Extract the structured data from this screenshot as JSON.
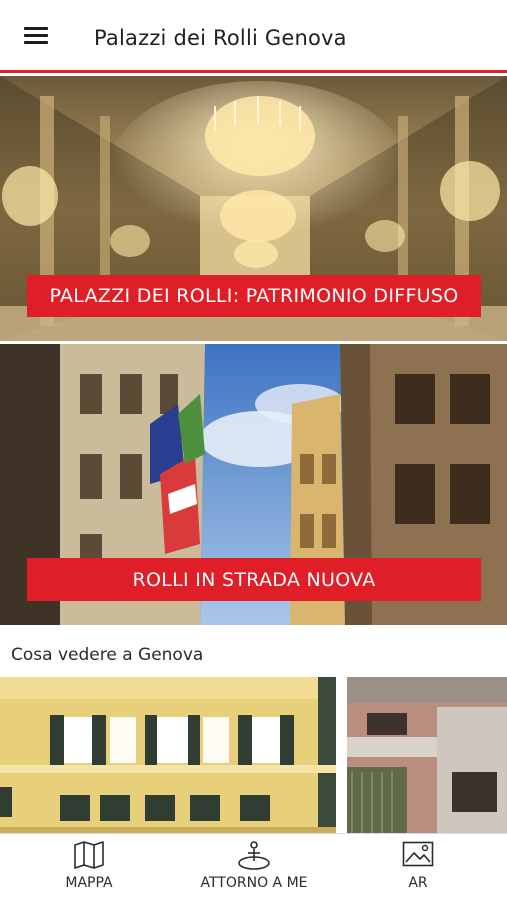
{
  "header": {
    "title": "Palazzi dei Rolli Genova",
    "menu_icon": "hamburger-menu-icon"
  },
  "features": [
    {
      "label": "PALAZZI DEI ROLLI: PATRIMONIO DIFFUSO",
      "image": "gilded-hall-chandeliers"
    },
    {
      "label": "ROLLI IN STRADA NUOVA",
      "image": "strada-nuova-street-flags"
    }
  ],
  "section": {
    "title": "Cosa vedere a Genova",
    "cards": [
      {
        "image": "yellow-palazzo-facade"
      },
      {
        "image": "stone-palazzo-facade"
      }
    ]
  },
  "bottom_nav": [
    {
      "label": "MAPPA",
      "icon": "map-icon"
    },
    {
      "label": "ATTORNO A ME",
      "icon": "location-person-icon"
    },
    {
      "label": "AR",
      "icon": "image-icon"
    }
  ],
  "colors": {
    "accent": "#e01e28",
    "header_border": "#e3202c",
    "background": "#ffffff"
  }
}
